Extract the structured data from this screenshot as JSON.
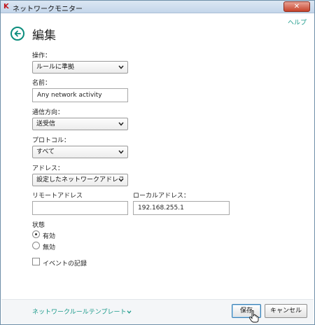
{
  "window": {
    "title": "ネットワークモニター",
    "close_label": "✕"
  },
  "help": {
    "label": "ヘルプ"
  },
  "page": {
    "title": "編集"
  },
  "form": {
    "operation": {
      "label": "操作：",
      "value": "ルールに準拠"
    },
    "name": {
      "label": "名前：",
      "value": "Any network activity"
    },
    "direction": {
      "label": "通信方向：",
      "value": "送受信"
    },
    "protocol": {
      "label": "プロトコル：",
      "value": "すべて"
    },
    "address": {
      "label": "アドレス：",
      "value": "設定したネットワークアドレス"
    },
    "remote_address": {
      "label": "リモートアドレス",
      "value": ""
    },
    "local_address": {
      "label": "ローカルアドレス：",
      "value": "192.168.255.1"
    },
    "status": {
      "label": "状態",
      "options": [
        {
          "label": "有効",
          "selected": true
        },
        {
          "label": "無効",
          "selected": false
        }
      ]
    },
    "log_events": {
      "label": "イベントの記録",
      "checked": false
    }
  },
  "footer": {
    "templates_link": "ネットワークルールテンプレート",
    "save_label": "保存",
    "cancel_label": "キャンセル"
  },
  "colors": {
    "accent": "#0b8d7d",
    "link": "#1a9a8a",
    "brand_red": "#c0141a"
  },
  "icons": {
    "app": "kaspersky-k-icon",
    "back": "back-arrow-circle-icon",
    "dropdown": "chevron-down-icon",
    "templates_chevron": "chevron-down-icon",
    "cursor": "hand-pointer-icon"
  }
}
